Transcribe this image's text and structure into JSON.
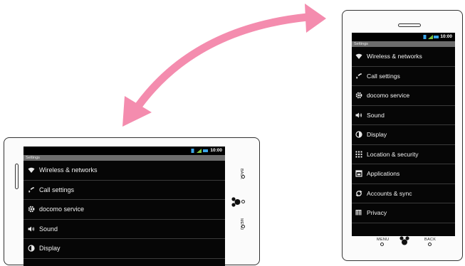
{
  "status_bar": {
    "time": "10:00",
    "icons": [
      "sd-card-icon",
      "signal-icon",
      "battery-icon"
    ]
  },
  "settings": {
    "title": "Settings",
    "items": [
      {
        "label": "Wireless & networks",
        "icon": "wifi-icon"
      },
      {
        "label": "Call settings",
        "icon": "phone-icon"
      },
      {
        "label": "docomo service",
        "icon": "gear-icon"
      },
      {
        "label": "Sound",
        "icon": "speaker-icon"
      },
      {
        "label": "Display",
        "icon": "display-icon"
      },
      {
        "label": "Location & security",
        "icon": "grid-icon"
      },
      {
        "label": "Applications",
        "icon": "apps-icon"
      },
      {
        "label": "Accounts & sync",
        "icon": "sync-icon"
      },
      {
        "label": "Privacy",
        "icon": "privacy-icon"
      }
    ]
  },
  "hardware_keys": {
    "menu": "MENU",
    "back": "BACK"
  },
  "colors": {
    "arrow": "#f48cae",
    "screen": "#060606",
    "title_bar": "#6d6d6d"
  }
}
